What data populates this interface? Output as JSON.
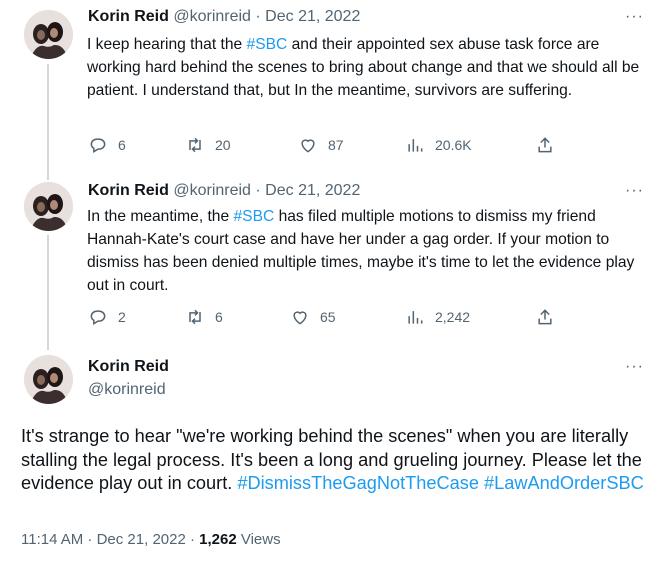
{
  "tweets": [
    {
      "name": "Korin Reid",
      "handle_time": "@korinreid · Dec 21, 2022",
      "parts": [
        "I keep hearing that the ",
        "#SBC",
        " and their appointed sex abuse task force are working hard behind the scenes to bring about change and that we should all be patient. I understand that, but In the meantime, survivors are suffering."
      ],
      "replies": "6",
      "retweets": "20",
      "likes": "87",
      "views": "20.6K"
    },
    {
      "name": "Korin Reid",
      "handle_time": "@korinreid · Dec 21, 2022",
      "parts": [
        "In the meantime, the ",
        "#SBC",
        " has filed multiple motions to dismiss my friend Hannah-Kate's court case and have her under a gag order. If your motion to dismiss has been denied multiple times, maybe it's time to let the evidence play out in court."
      ],
      "replies": "2",
      "retweets": "6",
      "likes": "65",
      "views": "2,242"
    }
  ],
  "main": {
    "name": "Korin Reid",
    "handle": "@korinreid",
    "text": "It's strange to hear \"we're working behind the scenes\" when you are literally stalling the legal process. It's been a long and grueling journey. Please let the evidence play out in court. ",
    "tags": [
      "#DismissTheGagNotTheCase",
      "#LawAndOrderSBC"
    ],
    "time": "11:14 AM · Dec 21, 2022 · ",
    "views_count": "1,262",
    "views_label": " Views"
  },
  "more_label": "···",
  "colors": {
    "link": "#1d9bf0",
    "muted": "#536471",
    "text": "#0f1419",
    "line": "#cfd9de"
  },
  "icons": [
    "reply-icon",
    "retweet-icon",
    "like-icon",
    "views-icon",
    "share-icon"
  ]
}
